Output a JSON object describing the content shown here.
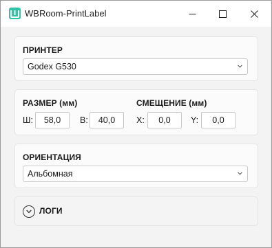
{
  "window": {
    "title": "WBRoom-PrintLabel",
    "accent_color": "#2ec4a6",
    "controls": [
      "minimize-icon",
      "maximize-icon",
      "close-icon"
    ]
  },
  "printer": {
    "heading": "ПРИНТЕР",
    "selected": "Godex G530"
  },
  "size": {
    "heading": "РАЗМЕР (мм)",
    "width_label": "Ш:",
    "width_value": "58,0",
    "height_label": "В:",
    "height_value": "40,0"
  },
  "offset": {
    "heading": "СМЕЩЕНИЕ (мм)",
    "x_label": "X:",
    "x_value": "0,0",
    "y_label": "Y:",
    "y_value": "0,0"
  },
  "orientation": {
    "heading": "ОРИЕНТАЦИЯ",
    "selected": "Альбомная"
  },
  "logs": {
    "heading": "ЛОГИ",
    "expanded": false
  }
}
